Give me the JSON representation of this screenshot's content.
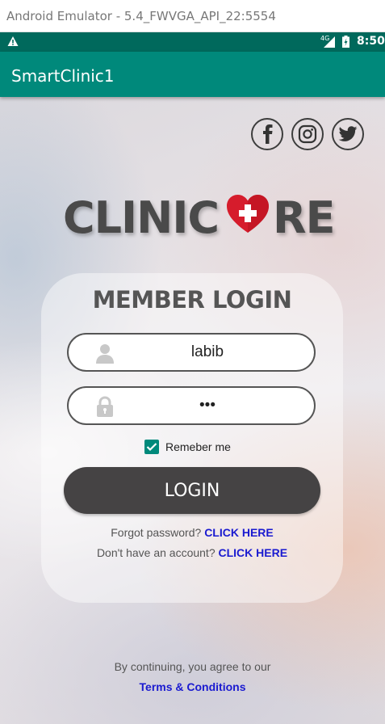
{
  "emulator": {
    "title": "Android Emulator - 5.4_FWVGA_API_22:5554"
  },
  "status_bar": {
    "network": "4G",
    "time": "8:50"
  },
  "app_bar": {
    "title": "SmartClinic1"
  },
  "social": [
    {
      "icon": "facebook-icon"
    },
    {
      "icon": "instagram-icon"
    },
    {
      "icon": "twitter-icon"
    }
  ],
  "logo": {
    "text_before": "CLINIC",
    "text_after": "RE"
  },
  "login": {
    "title": "MEMBER LOGIN",
    "username_value": "labib",
    "password_value": "•••",
    "remember_label": "Remeber me",
    "remember_checked": true,
    "button_label": "LOGIN",
    "forgot_text": "Forgot password?",
    "forgot_link": "CLICK HERE",
    "signup_text": "Don't have an account?",
    "signup_link": "CLICK HERE"
  },
  "footer": {
    "agree_text": "By continuing, you agree to our",
    "terms_link": "Terms & Conditions"
  },
  "colors": {
    "status_bar": "#00695c",
    "app_bar": "#00897b",
    "button": "#454344",
    "link": "#1a1ad0",
    "heart": "#d61c2c"
  }
}
